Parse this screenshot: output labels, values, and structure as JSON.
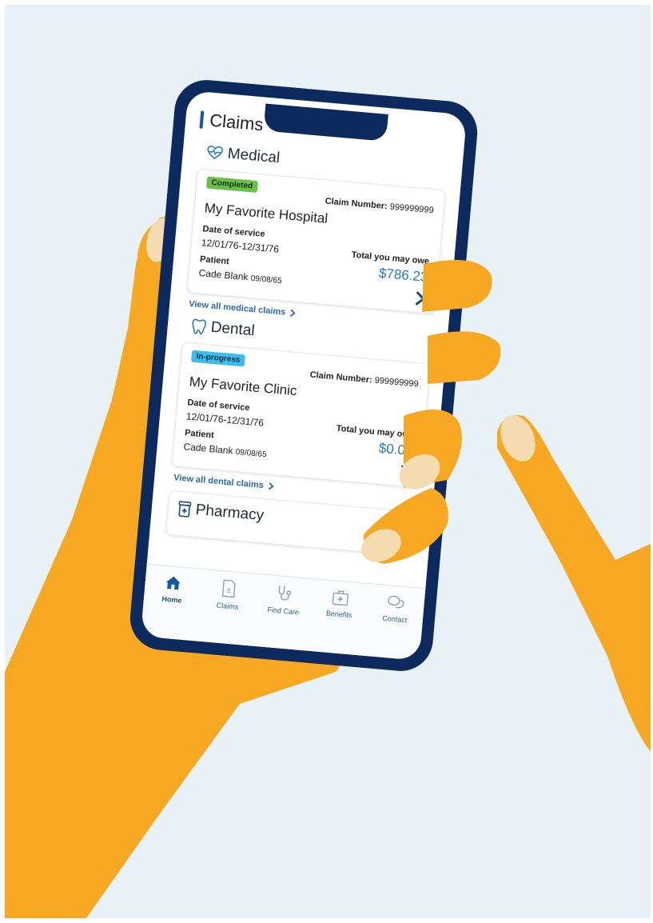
{
  "page_title": "Claims",
  "medical": {
    "heading": "Medical",
    "icon": "heart-pulse-icon",
    "card": {
      "status": "Completed",
      "claim_number_label": "Claim Number:",
      "claim_number": "999999999",
      "provider": "My Favorite Hospital",
      "date_label": "Date of service",
      "date_value": "12/01/76-12/31/76",
      "patient_label": "Patient",
      "patient_name": "Cade Blank",
      "patient_dob": "09/08/65",
      "owe_label": "Total you may owe",
      "owe_value": "$786.23"
    },
    "view_all": "View all medical claims"
  },
  "dental": {
    "heading": "Dental",
    "icon": "tooth-icon",
    "card": {
      "status": "In-progress",
      "claim_number_label": "Claim Number:",
      "claim_number": "999999999",
      "provider": "My Favorite Clinic",
      "date_label": "Date of service",
      "date_value": "12/01/76-12/31/76",
      "patient_label": "Patient",
      "patient_name": "Cade Blank",
      "patient_dob": "09/08/65",
      "owe_label": "Total you may owe",
      "owe_value": "$0.00"
    },
    "view_all": "View all dental claims"
  },
  "pharmacy": {
    "heading": "Pharmacy",
    "icon": "pill-bottle-icon"
  },
  "tabs": [
    {
      "label": "Home",
      "icon": "home-icon",
      "active": true
    },
    {
      "label": "Claims",
      "icon": "claims-document-icon",
      "active": false
    },
    {
      "label": "Find Care",
      "icon": "stethoscope-icon",
      "active": false
    },
    {
      "label": "Benefits",
      "icon": "medical-kit-icon",
      "active": false
    },
    {
      "label": "Contact",
      "icon": "chat-bubbles-icon",
      "active": false
    }
  ],
  "colors": {
    "background": "#e8f1f6",
    "hand": "#f7a823",
    "fingernail": "#f5dcb0",
    "phone_frame": "#0d2a5e",
    "accent_blue": "#14599e",
    "completed_badge": "#6cc04a",
    "in_progress_badge": "#38bdf0",
    "amount_blue": "#2379c2"
  }
}
